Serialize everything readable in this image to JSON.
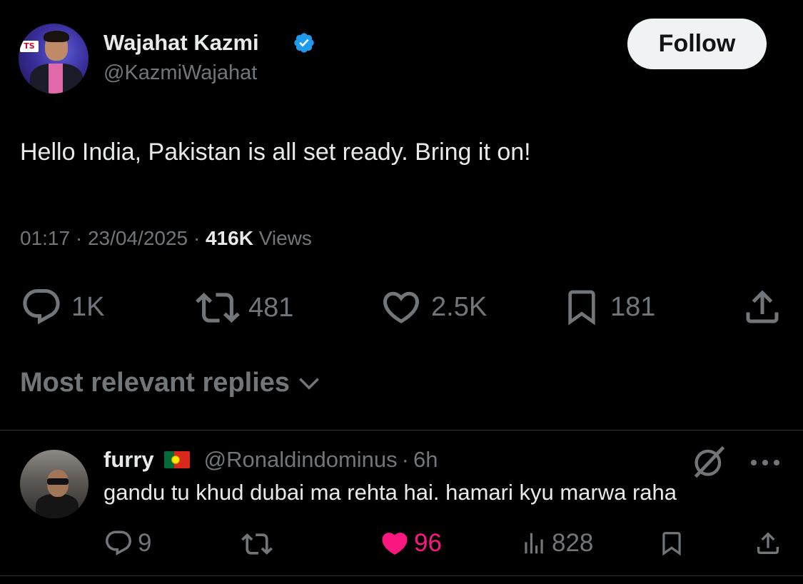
{
  "post": {
    "author_name": "Wajahat Kazmi",
    "author_handle": "@KazmiWajahat",
    "avatar_logo_text": "TS",
    "follow_label": "Follow",
    "text": "Hello India, Pakistan is all set ready. Bring it on!",
    "time": "01:17",
    "date": "23/04/2025",
    "views_count": "416K",
    "views_label": "Views",
    "replies": "1K",
    "reposts": "481",
    "likes": "2.5K",
    "bookmarks": "181"
  },
  "sort": {
    "label": "Most relevant replies"
  },
  "reply": {
    "author_name": "furry",
    "author_handle": "@Ronaldindominus",
    "age": "6h",
    "text": "gandu tu khud dubai ma rehta hai. hamari kyu marwa raha",
    "replies": "9",
    "likes": "96",
    "views": "828"
  },
  "colors": {
    "background": "#000000",
    "text_primary": "#e7e9ea",
    "text_secondary": "#71767b",
    "verified_blue": "#1d9bf0",
    "like_pink": "#f91880",
    "follow_bg": "#eff3f4"
  },
  "icons": {
    "verified": "verified-badge-icon",
    "reply": "speech-bubble-icon",
    "repost": "repost-arrows-icon",
    "like": "heart-icon",
    "bookmark": "bookmark-icon",
    "share": "share-upload-icon",
    "views": "bar-chart-icon",
    "grok": "grok-slash-icon",
    "more": "more-dots-icon",
    "chevron": "chevron-down-icon"
  }
}
